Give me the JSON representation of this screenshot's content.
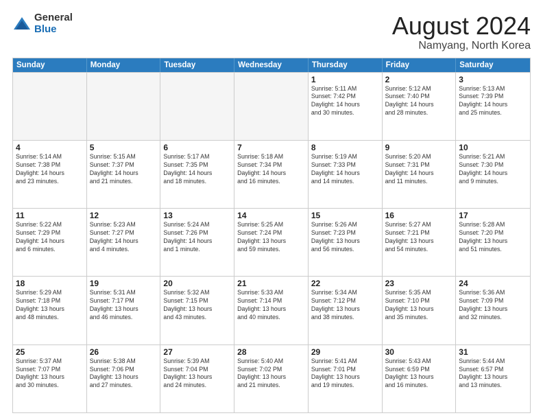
{
  "logo": {
    "general": "General",
    "blue": "Blue"
  },
  "title": "August 2024",
  "location": "Namyang, North Korea",
  "headers": [
    "Sunday",
    "Monday",
    "Tuesday",
    "Wednesday",
    "Thursday",
    "Friday",
    "Saturday"
  ],
  "weeks": [
    [
      {
        "day": "",
        "info": "",
        "empty": true
      },
      {
        "day": "",
        "info": "",
        "empty": true
      },
      {
        "day": "",
        "info": "",
        "empty": true
      },
      {
        "day": "",
        "info": "",
        "empty": true
      },
      {
        "day": "1",
        "info": "Sunrise: 5:11 AM\nSunset: 7:42 PM\nDaylight: 14 hours\nand 30 minutes.",
        "empty": false
      },
      {
        "day": "2",
        "info": "Sunrise: 5:12 AM\nSunset: 7:40 PM\nDaylight: 14 hours\nand 28 minutes.",
        "empty": false
      },
      {
        "day": "3",
        "info": "Sunrise: 5:13 AM\nSunset: 7:39 PM\nDaylight: 14 hours\nand 25 minutes.",
        "empty": false
      }
    ],
    [
      {
        "day": "4",
        "info": "Sunrise: 5:14 AM\nSunset: 7:38 PM\nDaylight: 14 hours\nand 23 minutes.",
        "empty": false
      },
      {
        "day": "5",
        "info": "Sunrise: 5:15 AM\nSunset: 7:37 PM\nDaylight: 14 hours\nand 21 minutes.",
        "empty": false
      },
      {
        "day": "6",
        "info": "Sunrise: 5:17 AM\nSunset: 7:35 PM\nDaylight: 14 hours\nand 18 minutes.",
        "empty": false
      },
      {
        "day": "7",
        "info": "Sunrise: 5:18 AM\nSunset: 7:34 PM\nDaylight: 14 hours\nand 16 minutes.",
        "empty": false
      },
      {
        "day": "8",
        "info": "Sunrise: 5:19 AM\nSunset: 7:33 PM\nDaylight: 14 hours\nand 14 minutes.",
        "empty": false
      },
      {
        "day": "9",
        "info": "Sunrise: 5:20 AM\nSunset: 7:31 PM\nDaylight: 14 hours\nand 11 minutes.",
        "empty": false
      },
      {
        "day": "10",
        "info": "Sunrise: 5:21 AM\nSunset: 7:30 PM\nDaylight: 14 hours\nand 9 minutes.",
        "empty": false
      }
    ],
    [
      {
        "day": "11",
        "info": "Sunrise: 5:22 AM\nSunset: 7:29 PM\nDaylight: 14 hours\nand 6 minutes.",
        "empty": false
      },
      {
        "day": "12",
        "info": "Sunrise: 5:23 AM\nSunset: 7:27 PM\nDaylight: 14 hours\nand 4 minutes.",
        "empty": false
      },
      {
        "day": "13",
        "info": "Sunrise: 5:24 AM\nSunset: 7:26 PM\nDaylight: 14 hours\nand 1 minute.",
        "empty": false
      },
      {
        "day": "14",
        "info": "Sunrise: 5:25 AM\nSunset: 7:24 PM\nDaylight: 13 hours\nand 59 minutes.",
        "empty": false
      },
      {
        "day": "15",
        "info": "Sunrise: 5:26 AM\nSunset: 7:23 PM\nDaylight: 13 hours\nand 56 minutes.",
        "empty": false
      },
      {
        "day": "16",
        "info": "Sunrise: 5:27 AM\nSunset: 7:21 PM\nDaylight: 13 hours\nand 54 minutes.",
        "empty": false
      },
      {
        "day": "17",
        "info": "Sunrise: 5:28 AM\nSunset: 7:20 PM\nDaylight: 13 hours\nand 51 minutes.",
        "empty": false
      }
    ],
    [
      {
        "day": "18",
        "info": "Sunrise: 5:29 AM\nSunset: 7:18 PM\nDaylight: 13 hours\nand 48 minutes.",
        "empty": false
      },
      {
        "day": "19",
        "info": "Sunrise: 5:31 AM\nSunset: 7:17 PM\nDaylight: 13 hours\nand 46 minutes.",
        "empty": false
      },
      {
        "day": "20",
        "info": "Sunrise: 5:32 AM\nSunset: 7:15 PM\nDaylight: 13 hours\nand 43 minutes.",
        "empty": false
      },
      {
        "day": "21",
        "info": "Sunrise: 5:33 AM\nSunset: 7:14 PM\nDaylight: 13 hours\nand 40 minutes.",
        "empty": false
      },
      {
        "day": "22",
        "info": "Sunrise: 5:34 AM\nSunset: 7:12 PM\nDaylight: 13 hours\nand 38 minutes.",
        "empty": false
      },
      {
        "day": "23",
        "info": "Sunrise: 5:35 AM\nSunset: 7:10 PM\nDaylight: 13 hours\nand 35 minutes.",
        "empty": false
      },
      {
        "day": "24",
        "info": "Sunrise: 5:36 AM\nSunset: 7:09 PM\nDaylight: 13 hours\nand 32 minutes.",
        "empty": false
      }
    ],
    [
      {
        "day": "25",
        "info": "Sunrise: 5:37 AM\nSunset: 7:07 PM\nDaylight: 13 hours\nand 30 minutes.",
        "empty": false
      },
      {
        "day": "26",
        "info": "Sunrise: 5:38 AM\nSunset: 7:06 PM\nDaylight: 13 hours\nand 27 minutes.",
        "empty": false
      },
      {
        "day": "27",
        "info": "Sunrise: 5:39 AM\nSunset: 7:04 PM\nDaylight: 13 hours\nand 24 minutes.",
        "empty": false
      },
      {
        "day": "28",
        "info": "Sunrise: 5:40 AM\nSunset: 7:02 PM\nDaylight: 13 hours\nand 21 minutes.",
        "empty": false
      },
      {
        "day": "29",
        "info": "Sunrise: 5:41 AM\nSunset: 7:01 PM\nDaylight: 13 hours\nand 19 minutes.",
        "empty": false
      },
      {
        "day": "30",
        "info": "Sunrise: 5:43 AM\nSunset: 6:59 PM\nDaylight: 13 hours\nand 16 minutes.",
        "empty": false
      },
      {
        "day": "31",
        "info": "Sunrise: 5:44 AM\nSunset: 6:57 PM\nDaylight: 13 hours\nand 13 minutes.",
        "empty": false
      }
    ]
  ]
}
